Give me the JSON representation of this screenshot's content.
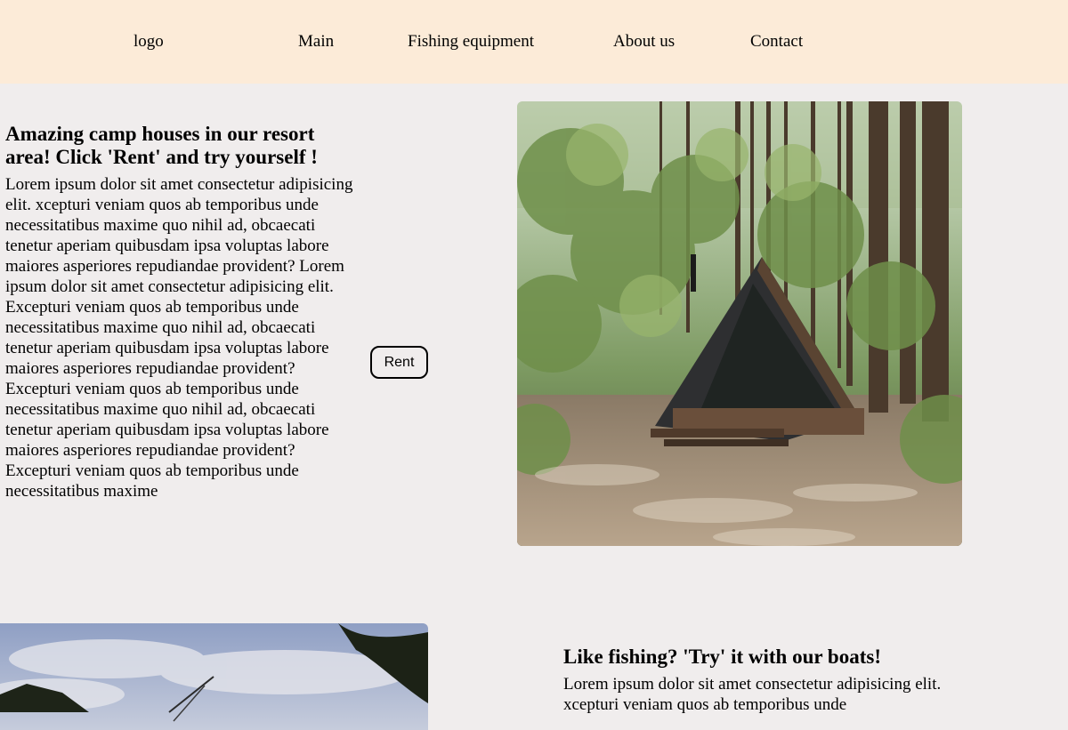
{
  "header": {
    "logo": "logo",
    "nav": [
      "Main",
      "Fishing equipment",
      "About us",
      "Contact"
    ]
  },
  "section1": {
    "title": "Amazing camp houses in our resort area! Click 'Rent' and try yourself !",
    "body": "Lorem ipsum dolor sit amet consectetur adipisicing elit. xcepturi veniam quos ab temporibus unde necessitatibus maxime quo nihil ad, obcaecati tenetur aperiam quibusdam ipsa voluptas labore maiores asperiores repudiandae provident? Lorem ipsum dolor sit amet consectetur adipisicing elit. Excepturi veniam quos ab temporibus unde necessitatibus maxime quo nihil ad, obcaecati tenetur aperiam quibusdam ipsa voluptas labore maiores asperiores repudiandae provident? Excepturi veniam quos ab temporibus unde necessitatibus maxime quo nihil ad, obcaecati tenetur aperiam quibusdam ipsa voluptas labore maiores asperiores repudiandae provident? Excepturi veniam quos ab temporibus unde necessitatibus maxime",
    "button": "Rent"
  },
  "section2": {
    "title": "Like fishing? 'Try' it with our boats!",
    "body": "Lorem ipsum dolor sit amet consectetur adipisicing elit. xcepturi veniam quos ab temporibus unde"
  },
  "colors": {
    "header_bg": "#fcebd8",
    "page_bg": "#f0eded"
  }
}
